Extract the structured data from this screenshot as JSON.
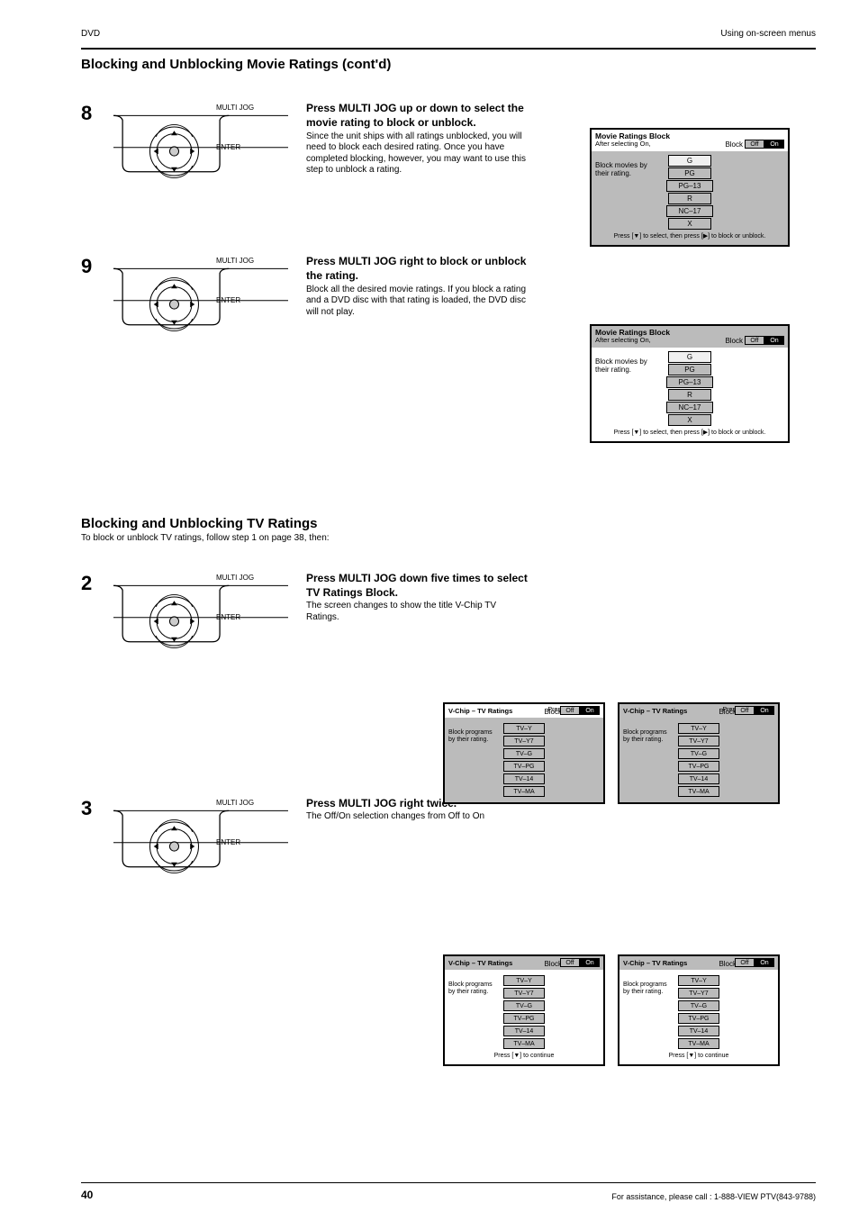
{
  "header": {
    "left": "DVD",
    "right": "Using on-screen menus"
  },
  "title": "Blocking and Unblocking Movie Ratings (cont'd)",
  "section1": {
    "steps": {
      "8": {
        "num": "8",
        "line1": "Press MULTI JOG up or down to select the",
        "line2": "movie rating to block or unblock.",
        "note": "Since the unit ships with all ratings unblocked, you will need to block each desired rating. Once you have completed blocking, however, you may want to use this step to unblock a rating."
      },
      "9": {
        "num": "9",
        "line1": "Press MULTI JOG right to block or unblock",
        "line2": "the rating.",
        "note": "Block all the desired movie ratings. If you block a rating and a DVD disc with that rating is loaded, the DVD disc will not play."
      }
    },
    "panel8": {
      "title": "Movie Ratings Block",
      "block_label": "Block",
      "toggle": {
        "off": "Off",
        "on": "On"
      },
      "side": "Block movies by their rating.",
      "after": "After selecting On,",
      "instr": "Press [▼] to select, then press [▶] to block or unblock.",
      "ratings": [
        "G",
        "PG",
        "PG–13",
        "R",
        "NC–17",
        "X"
      ]
    }
  },
  "section2": {
    "title": "Blocking and Unblocking TV Ratings",
    "intro": "To block or unblock TV ratings, follow step 1 on page 38, then:",
    "steps": {
      "2": {
        "num": "2",
        "line1": "Press MULTI JOG down five times to select",
        "line2": "TV Ratings Block.",
        "note": "The screen changes to show the title V-Chip TV Ratings."
      },
      "3": {
        "num": "3",
        "line1": "Press MULTI JOG right twice.",
        "line2": "",
        "note": "The Off/On selection changes from Off to On"
      }
    },
    "panel2": {
      "title": "V-Chip – TV Ratings",
      "adjust": "Press [▶] to adjust",
      "block_label": "Block",
      "toggle": {
        "off": "Off",
        "on": "On"
      },
      "side": "Block programs by their rating.",
      "ratings": [
        "TV–Y",
        "TV–Y7",
        "TV–G",
        "TV–PG",
        "TV–14",
        "TV–MA"
      ],
      "instr": "Press [▼] to continue"
    }
  },
  "footer": {
    "page": "40",
    "note": "For assistance, please call : 1-888-VIEW PTV(843-9788)"
  }
}
